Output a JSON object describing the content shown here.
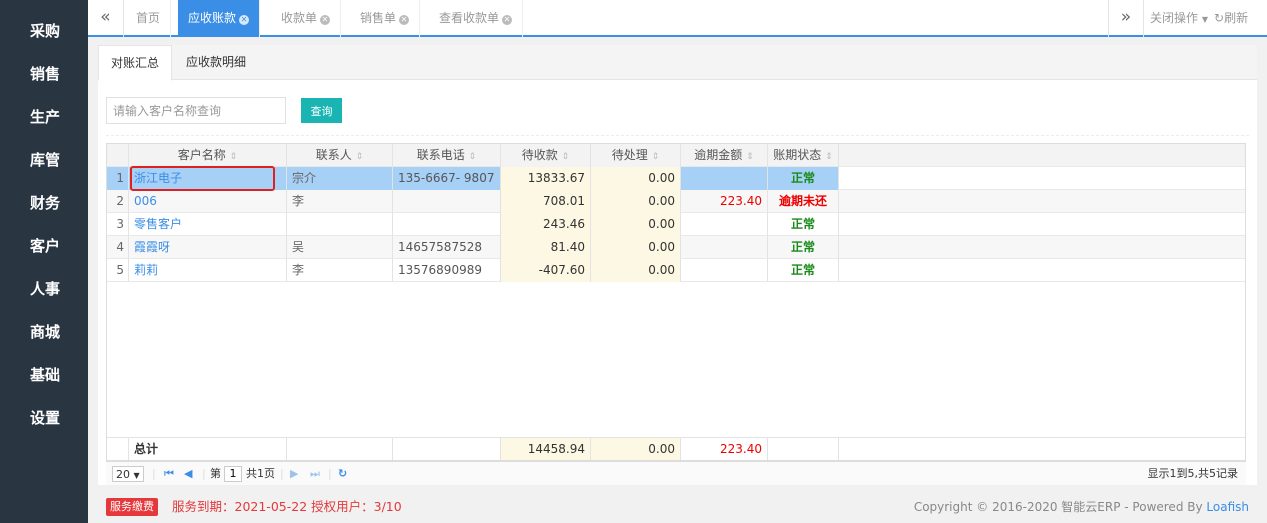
{
  "sidebar": {
    "items": [
      {
        "label": "采购"
      },
      {
        "label": "销售"
      },
      {
        "label": "生产"
      },
      {
        "label": "库管"
      },
      {
        "label": "财务"
      },
      {
        "label": "客户"
      },
      {
        "label": "人事"
      },
      {
        "label": "商城"
      },
      {
        "label": "基础"
      },
      {
        "label": "设置"
      }
    ]
  },
  "tabbar": {
    "left_arrow": "«",
    "right_arrow": "»",
    "tabs": [
      {
        "label": "首页"
      },
      {
        "label": "应收账款"
      },
      {
        "label": "收款单"
      },
      {
        "label": "销售单"
      },
      {
        "label": "查看收款单"
      }
    ],
    "close_ops": "关闭操作",
    "refresh": "刷新"
  },
  "subtabs": [
    {
      "label": "对账汇总"
    },
    {
      "label": "应收款明细"
    }
  ],
  "search": {
    "placeholder": "请输入客户名称查询",
    "value": "",
    "button": "查询"
  },
  "table": {
    "headers": {
      "name": "客户名称",
      "contact": "联系人",
      "phone": "联系电话",
      "receivable": "待收款",
      "pending": "待处理",
      "overdue": "逾期金额",
      "status": "账期状态"
    },
    "rows": [
      {
        "n": "1",
        "name": "浙江电子",
        "contact": "宗介",
        "phone": "135-6667- 9807",
        "receivable": "13833.67",
        "pending": "0.00",
        "overdue": "",
        "status": "正常"
      },
      {
        "n": "2",
        "name": "006",
        "contact": "李",
        "phone": "",
        "receivable": "708.01",
        "pending": "0.00",
        "overdue": "223.40",
        "status": "逾期未还"
      },
      {
        "n": "3",
        "name": "零售客户",
        "contact": "",
        "phone": "",
        "receivable": "243.46",
        "pending": "0.00",
        "overdue": "",
        "status": "正常"
      },
      {
        "n": "4",
        "name": "霞霞呀",
        "contact": "吴",
        "phone": "14657587528",
        "receivable": "81.40",
        "pending": "0.00",
        "overdue": "",
        "status": "正常"
      },
      {
        "n": "5",
        "name": "莉莉",
        "contact": "李",
        "phone": "13576890989",
        "receivable": "-407.60",
        "pending": "0.00",
        "overdue": "",
        "status": "正常"
      }
    ],
    "footer": {
      "label": "总计",
      "receivable": "14458.94",
      "pending": "0.00",
      "overdue": "223.40"
    }
  },
  "pager": {
    "page_size": "20",
    "page_prefix": "第",
    "page": "1",
    "total_pages": "共1页",
    "summary": "显示1到5,共5记录"
  },
  "bottom": {
    "fee_button": "服务缴费",
    "expire": "服务到期：2021-05-22   授权用户：3/10",
    "copyright": "Copyright © 2016-2020 智能云ERP - Powered By ",
    "brand": "Loafish"
  },
  "colors": {
    "accent": "#3a8ee6",
    "sidebar_bg": "#2a3542",
    "query_button": "#1ab5b3",
    "status_ok": "#1a8a1a",
    "status_bad": "#e00000",
    "selected_row": "#a7d0f7"
  },
  "icons": {
    "tab_close": "close-circle-icon",
    "refresh": "refresh-icon",
    "first_page": "first-page-icon",
    "prev_page": "prev-page-icon",
    "next_page": "next-page-icon",
    "last_page": "last-page-icon",
    "reload": "reload-icon"
  }
}
